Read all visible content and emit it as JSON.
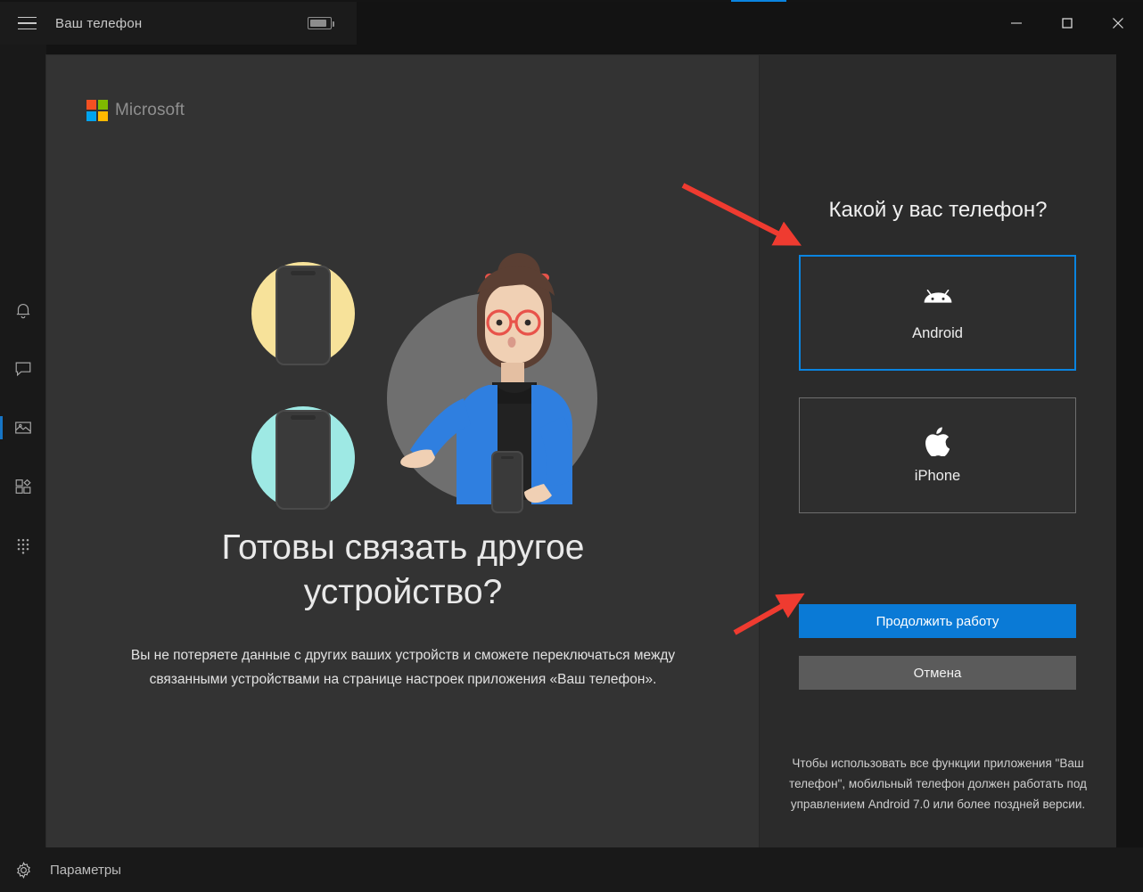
{
  "window": {
    "app_title": "Ваш телефон",
    "hamburger_icon": "hamburger-menu-icon",
    "battery_icon": "battery-icon",
    "minimize_label": "Свернуть",
    "maximize_label": "Развернуть",
    "close_label": "Закрыть"
  },
  "sidebar": {
    "items": [
      {
        "name": "notifications",
        "icon": "bell-icon",
        "selected": false
      },
      {
        "name": "messages",
        "icon": "message-bubble-icon",
        "selected": false
      },
      {
        "name": "photos",
        "icon": "photos-icon",
        "selected": true
      },
      {
        "name": "apps",
        "icon": "apps-icon",
        "selected": false
      },
      {
        "name": "calls",
        "icon": "dialpad-icon",
        "selected": false
      }
    ],
    "settings": {
      "label": "Параметры",
      "icon": "gear-icon"
    }
  },
  "dialog": {
    "brand": {
      "label": "Microsoft",
      "colors": {
        "red": "#f25022",
        "green": "#7fba00",
        "blue": "#00a4ef",
        "yellow": "#ffb900"
      }
    },
    "illustration": {
      "name": "link-device-illustration",
      "phone_circle_top_color": "#f7e29a",
      "phone_circle_bottom_color": "#9ee9e4",
      "person_circle_color": "#6f6f6f",
      "jacket_color": "#2f7fe0",
      "hair_color": "#5b3f33",
      "glasses_color": "#e8534a",
      "skin_color": "#f0d0b4"
    },
    "headline": "Готовы связать другое устройство?",
    "body": "Вы не потеряете данные с других ваших устройств и сможете переключаться между связанными устройствами на странице настроек приложения «Ваш телефон».",
    "right_panel": {
      "title": "Какой у вас телефон?",
      "choices": [
        {
          "label": "Android",
          "icon": "android-icon",
          "selected": true
        },
        {
          "label": "iPhone",
          "icon": "apple-icon",
          "selected": false
        }
      ],
      "primary_button": "Продолжить работу",
      "secondary_button": "Отмена",
      "note": "Чтобы использовать все функции приложения \"Ваш телефон\", мобильный телефон должен работать под управлением Android 7.0 или более поздней версии."
    }
  },
  "annotations": {
    "accent_color": "#ef3b30",
    "arrows": [
      {
        "name": "arrow-to-android-choice",
        "points_to": "android-choice"
      },
      {
        "name": "arrow-to-continue-button",
        "points_to": "primary-button"
      }
    ]
  }
}
